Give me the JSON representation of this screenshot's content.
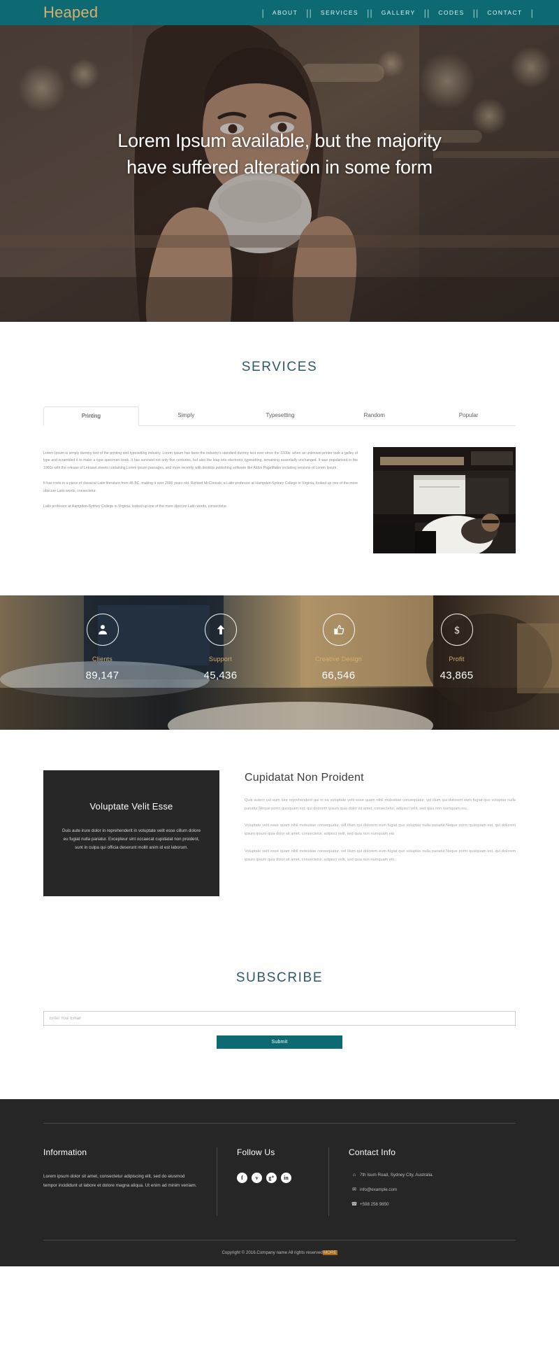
{
  "header": {
    "logo": "Heaped",
    "nav": [
      {
        "label": "ABOUT"
      },
      {
        "label": "SERVICES"
      },
      {
        "label": "GALLERY"
      },
      {
        "label": "CODES"
      },
      {
        "label": "CONTACT"
      }
    ],
    "colors": {
      "bar": "#0d6a73",
      "logo": "#d9ae6a"
    }
  },
  "hero": {
    "line1": "Lorem Ipsum available, but the majority",
    "line2": "have suffered alteration in some form",
    "image_alt": "woman-drinking-coffee-photo"
  },
  "services": {
    "title": "SERVICES",
    "tabs": [
      {
        "label": "Printing",
        "active": true
      },
      {
        "label": "Simply",
        "active": false
      },
      {
        "label": "Typesetting",
        "active": false
      },
      {
        "label": "Random",
        "active": false
      },
      {
        "label": "Popular",
        "active": false
      }
    ],
    "paragraphs": [
      "Lorem Ipsum is simply dummy text of the printing and typesetting industry. Lorem Ipsum has been the industry's standard dummy text ever since the 1500s, when an unknown printer took a galley of type and scrambled it to make a type specimen book. It has survived not only five centuries, but also the leap into electronic typesetting, remaining essentially unchanged. It was popularised in the 1960s with the release of Letraset sheets containing Lorem Ipsum passages, and more recently with desktop publishing software like Aldus PageMaker including versions of Lorem Ipsum.",
      "It has roots in a piece of classical Latin literature from 45 BC, making it over 2000 years old. Richard McClintock, a Latin professor at Hampden-Sydney College in Virginia, looked up one of the more obscure Latin words, consectetur.",
      "Latin professor at Hampden-Sydney College in Virginia, looked up one of the more obscure Latin words, consectetur."
    ],
    "image_alt": "man-working-at-desk-photo"
  },
  "stats": [
    {
      "icon": "user-icon",
      "label": "Clients",
      "value": "89,147"
    },
    {
      "icon": "arrow-up-icon",
      "label": "Support",
      "value": "45,436"
    },
    {
      "icon": "thumbs-up-icon",
      "label": "Creative Design",
      "value": "66,546"
    },
    {
      "icon": "dollar-icon",
      "label": "Profit",
      "value": "43,865"
    }
  ],
  "about": {
    "card_title": "Voluptate Velit Esse",
    "card_text": "Duis aute irure dolor in reprehenderit in voluptate velit esse cillum dolore eu fugiat nulla pariatur. Excepteur sint occaecat cupidatat non proident, sunt in culpa qui officia deserunt mollit anim id est laborum.",
    "heading": "Cupidatat Non Proident",
    "paragraphs": [
      "Quis autem vel eum iure reprehenderit qui in ea voluptate velit esse quam nihil molestiae consequatur. vel illum qui dolorem eum fugiat quo voluptas nulla pariatur.Neque porro quisquam est, qui dolorem ipsum quia dolor sit amet, consectetur, adipisci velit, sed quia non numquam eiu.",
      "Voluptate velit esse quam nihil molestiae consequatur. vel illum qui dolorem eum fugiat quo voluptas nulla pariatur.Neque porro quisquam est, qui dolorem ipsum ipsum quia dolor sit amet, consectetur, adipisci velit, sed quia non numquam eiu",
      "Voluptate velit esse quam nihil molestiae consequatur. vel illum qui dolorem eum fugiat quo voluptas nulla pariatur.Neque porro quisquam est, qui dolorem ipsum ipsum quia dolor sit amet, consectetur, adipisci velit, sed quia non numquam eiu"
    ]
  },
  "subscribe": {
    "title": "SUBSCRIBE",
    "placeholder": "Enter Your Email",
    "value": "",
    "button": "Submit",
    "button_color": "#0d6a73"
  },
  "footer": {
    "information": {
      "title": "Information",
      "text": "Lorem ipsum dolor sit amet, consectetur adipiscing elit, sed do eiusmod tempor incididunt ut labore et dolore magna aliqua. Ut enim ad minim veniam."
    },
    "follow": {
      "title": "Follow Us",
      "socials": [
        {
          "name": "facebook-icon",
          "glyph": "f"
        },
        {
          "name": "twitter-icon",
          "glyph": "ᴠ"
        },
        {
          "name": "google-plus-icon",
          "glyph": "g⁺"
        },
        {
          "name": "linkedin-icon",
          "glyph": "in"
        }
      ]
    },
    "contact": {
      "title": "Contact Info",
      "items": [
        {
          "icon": "home-icon",
          "glyph": "⌂",
          "text": "7th Isum Road, Sydney City, Australia."
        },
        {
          "icon": "envelope-icon",
          "glyph": "✉",
          "text": "info@example.com"
        },
        {
          "icon": "phone-icon",
          "glyph": "☎",
          "text": "+598 256 9850"
        }
      ]
    },
    "copyright_text": "Copyright © 2016.Company name All rights reserved",
    "copyright_highlight": "MORE"
  }
}
